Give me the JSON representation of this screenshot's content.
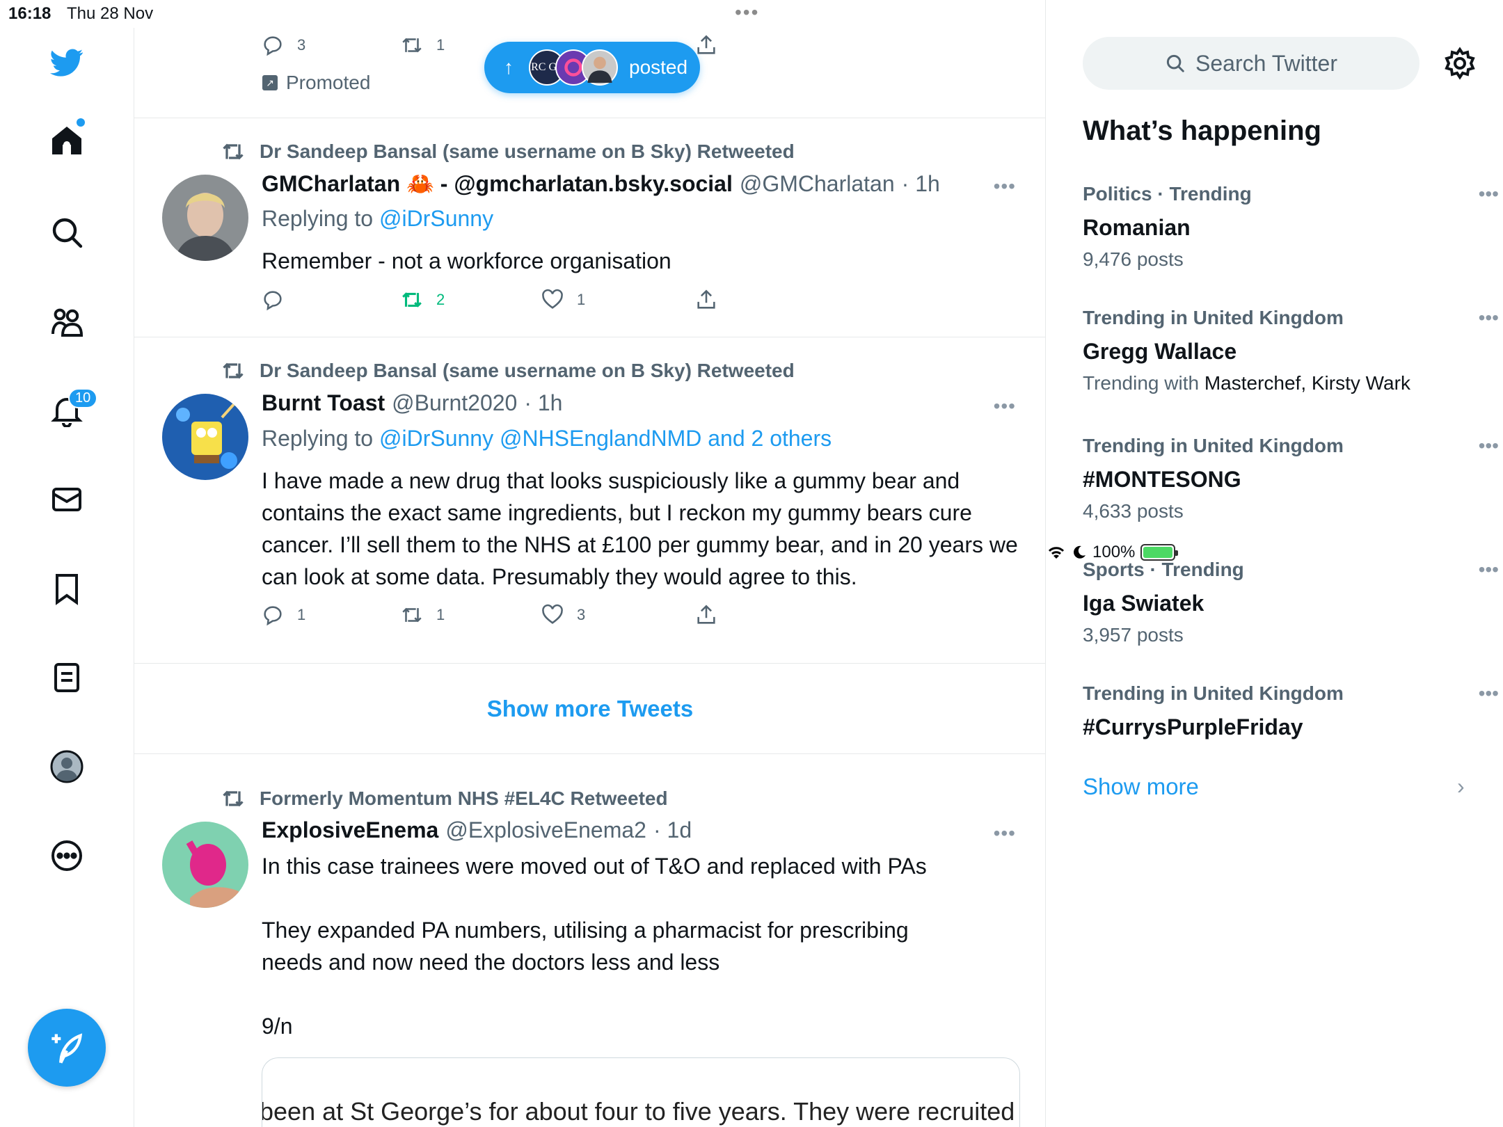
{
  "status_bar": {
    "time": "16:18",
    "date": "Thu 28 Nov",
    "battery": "100%"
  },
  "nav": {
    "notifications_badge": "10"
  },
  "colors": {
    "accent": "#1d9bf0",
    "retweet_green": "#00ba7c",
    "secondary_text": "#536471"
  },
  "top_tweet": {
    "replies": "3",
    "retweets": "1",
    "promoted_label": "Promoted"
  },
  "posted_pill": {
    "label": "posted",
    "first_avatar_text": "RC GP"
  },
  "tweets": [
    {
      "retweeted_by": "Dr Sandeep Bansal (same username on B Sky) Retweeted",
      "name": "GMCharlatan 🦀 - @gmcharlatan.bsky.social",
      "handle": "@GMCharlatan",
      "time": "· 1h",
      "replying_prefix": "Replying to",
      "replying_to": "@iDrSunny",
      "text": "Remember - not a workforce organisation",
      "replies": "",
      "retweets": "2",
      "likes": "1"
    },
    {
      "retweeted_by": "Dr Sandeep Bansal (same username on B Sky) Retweeted",
      "name": "Burnt Toast",
      "handle": "@Burnt2020",
      "time": "· 1h",
      "replying_prefix": "Replying to",
      "replying_to": "@iDrSunny @NHSEnglandNMD and 2 others",
      "text": "I have made a new drug that looks suspiciously like a gummy bear and contains the exact same ingredients, but I reckon my gummy bears cure cancer. I’ll sell them to the NHS at £100 per gummy bear, and in 20 years we can look at some data. Presumably they would agree to this.",
      "replies": "1",
      "retweets": "1",
      "likes": "3"
    },
    {
      "retweeted_by": "Formerly Momentum NHS #EL4C Retweeted",
      "name": "ExplosiveEnema",
      "handle": "@ExplosiveEnema2",
      "time": "· 1d",
      "text": "In this case trainees were moved out of T&O and replaced with PAs\n\nThey expanded PA numbers, utilising a pharmacist for prescribing\nneeds and now need the doctors less and less\n\n9/n",
      "embed_text": "been at St George’s for about four to five years. They were recruited in"
    }
  ],
  "show_more_tweets": "Show more Tweets",
  "sidebar": {
    "search_placeholder": "Search Twitter",
    "heading": "What’s happening",
    "trends": [
      {
        "meta": "Politics · Trending",
        "topic": "Romanian",
        "count": "9,476 posts"
      },
      {
        "meta": "Trending in United Kingdom",
        "topic": "Gregg Wallace",
        "count_prefix": "Trending with",
        "count_emph": "Masterchef, Kirsty Wark"
      },
      {
        "meta": "Trending in United Kingdom",
        "topic": "#MONTESONG",
        "count": "4,633 posts"
      },
      {
        "meta": "Sports · Trending",
        "topic": "Iga Swiatek",
        "count": "3,957 posts"
      },
      {
        "meta": "Trending in United Kingdom",
        "topic": "#CurrysPurpleFriday",
        "count": ""
      }
    ],
    "show_more": "Show more"
  }
}
